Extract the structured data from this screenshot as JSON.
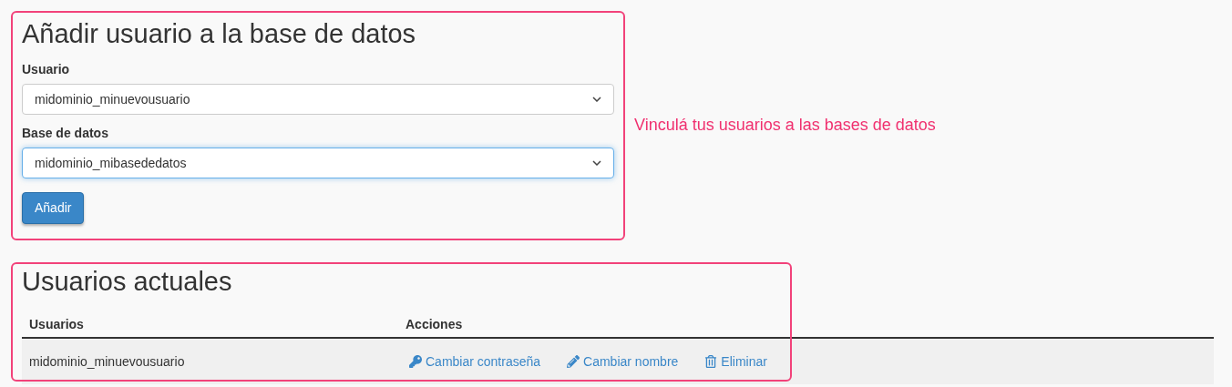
{
  "add_form": {
    "title": "Añadir usuario a la base de datos",
    "fields": [
      {
        "label": "Usuario",
        "value": "midominio_minuevousuario",
        "focused": false
      },
      {
        "label": "Base de datos",
        "value": "midominio_mibasededatos",
        "focused": true
      }
    ],
    "submit": "Añadir"
  },
  "annotation": "Vinculá tus usuarios a las bases de datos",
  "users_section": {
    "title": "Usuarios actuales",
    "columns": [
      "Usuarios",
      "Acciones"
    ],
    "rows": [
      {
        "user": "midominio_minuevousuario",
        "actions": [
          {
            "kind": "key",
            "label": "Cambiar contraseña"
          },
          {
            "kind": "pencil",
            "label": "Cambiar nombre"
          },
          {
            "kind": "trash",
            "label": "Eliminar"
          }
        ]
      }
    ]
  }
}
